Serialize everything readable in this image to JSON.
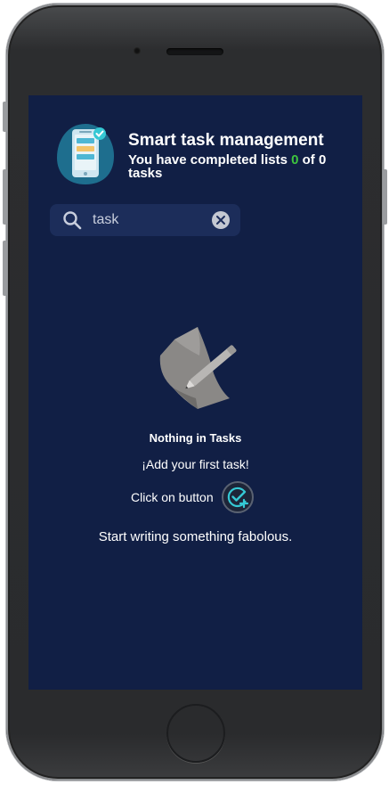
{
  "header": {
    "title": "Smart task management",
    "subtitle_prefix": "You have completed lists",
    "completed": "0",
    "of_text": "of",
    "total": "0",
    "suffix": "tasks"
  },
  "search": {
    "value": "task",
    "icon": "search-icon",
    "clear_icon": "close-icon"
  },
  "empty_state": {
    "title": "Nothing in Tasks",
    "add_text": "¡Add your first task!",
    "click_text": "Click on button",
    "button_icon": "add-task-icon",
    "footer": "Start writing something fabolous."
  },
  "colors": {
    "background": "#111f45",
    "accent_green": "#3ec63e",
    "accent_teal": "#35c8d4"
  }
}
